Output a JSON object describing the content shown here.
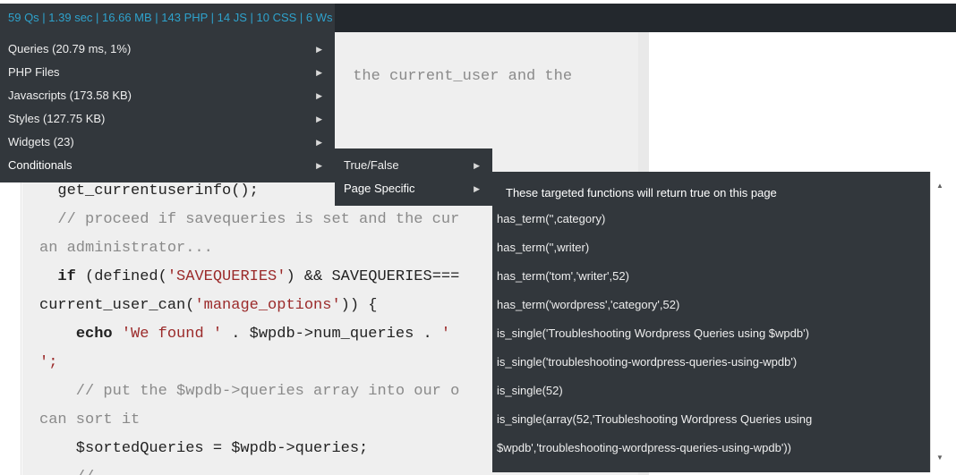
{
  "admin_bar": {
    "stats": "59 Qs | 1.39 sec | 16.66 MB | 143 PHP | 14 JS | 10 CSS | 6 Ws"
  },
  "main_menu": {
    "items": [
      {
        "label": "Queries (20.79 ms, 1%)"
      },
      {
        "label": "PHP Files"
      },
      {
        "label": "Javascripts (173.58 KB)"
      },
      {
        "label": "Styles (127.75 KB)"
      },
      {
        "label": "Widgets (23)"
      },
      {
        "label": "Conditionals"
      }
    ],
    "arrow_glyph": "▶"
  },
  "conditionals_submenu": {
    "items": [
      {
        "label": "True/False"
      },
      {
        "label": "Page Specific"
      }
    ]
  },
  "page_specific_panel": {
    "header": "These targeted functions will return true on this page",
    "rows": [
      "has_term('',category)",
      "has_term('',writer)",
      "has_term('tom','writer',52)",
      "has_term('wordpress','category',52)",
      "is_single('Troubleshooting Wordpress Queries using $wpdb')",
      "is_single('troubleshooting-wordpress-queries-using-wpdb')",
      "is_single(52)",
      "is_single(array(52,'Troubleshooting Wordpress Queries using",
      "$wpdb','troubleshooting-wordpress-queries-using-wpdb'))"
    ]
  },
  "code": {
    "line1_tail": " the current_user and the",
    "line2": "  get_currentuserinfo();",
    "line3": "  // proceed if savequeries is set and the cur",
    "line4": "an administrator...",
    "line5_kw": "if",
    "line5_a": " (defined(",
    "line5_str": "'SAVEQUERIES'",
    "line5_b": ") && SAVEQUERIES===",
    "line6_a": "current_user_can(",
    "line6_str": "'manage_options'",
    "line6_b": ")) {",
    "line7_kw": "echo",
    "line7_str": "'We found '",
    "line7_b": " . $wpdb->num_queries . ",
    "line7_str2": "'",
    "line8": "';",
    "line9": "    // put the $wpdb->queries array into our o",
    "line10": "can sort it",
    "line11": "    $sortedQueries = $wpdb->queries;",
    "line12": "    //"
  },
  "colors": {
    "admin_bar": "#23282d",
    "menu_bg": "#32373c",
    "stats_text": "#2ea2cc",
    "code_bg": "#efefef",
    "code_string": "#9b2a2a",
    "code_comment": "#8a8a8a"
  },
  "icons": {
    "submenu_arrow": "triangle-right-icon",
    "scroll_up": "triangle-up-icon",
    "scroll_down": "triangle-down-icon"
  }
}
